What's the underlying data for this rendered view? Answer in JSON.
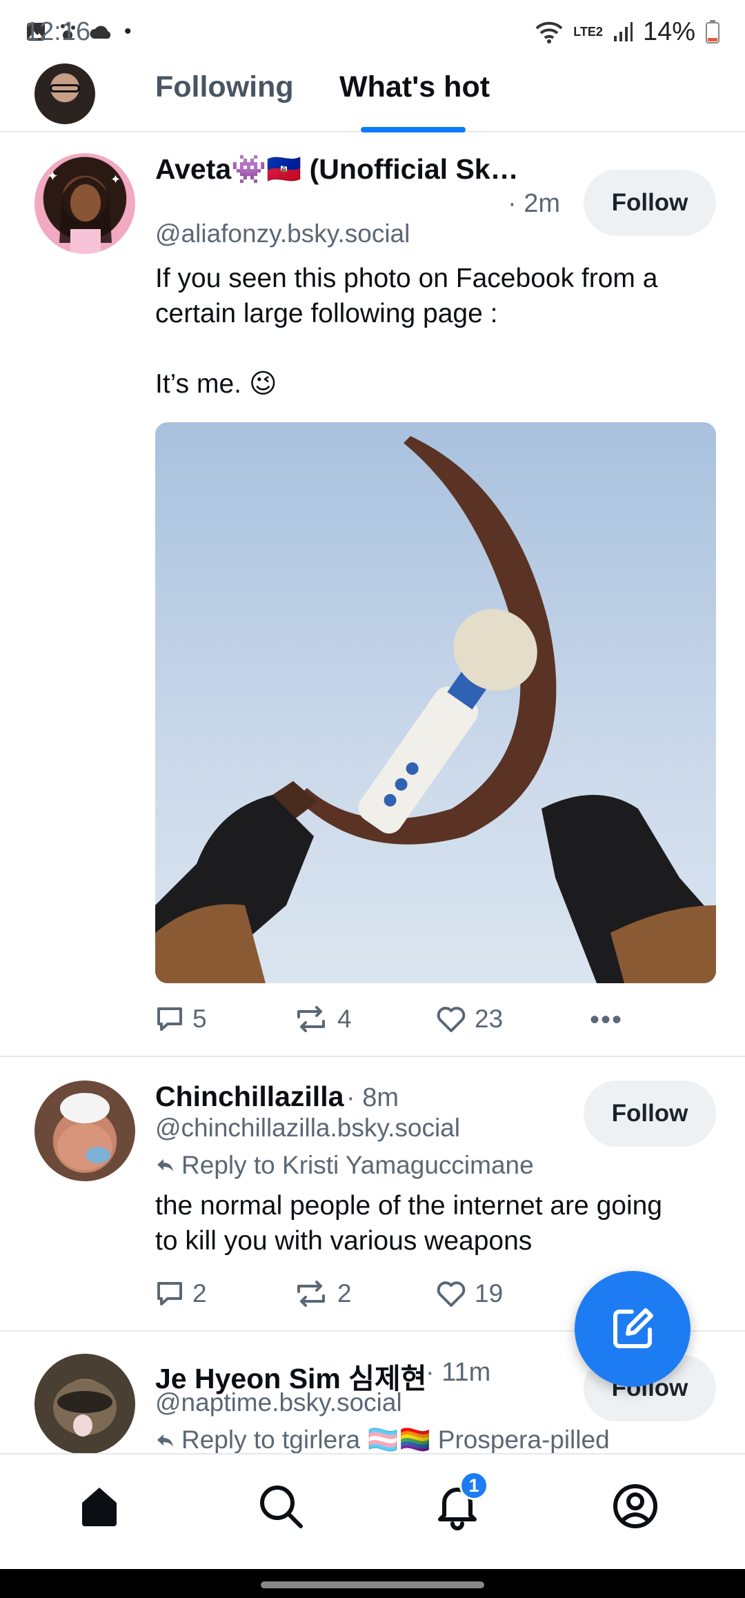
{
  "status_bar": {
    "time": "12:16",
    "network": "LTE2",
    "battery": "14%"
  },
  "header": {
    "tabs": [
      {
        "label": "Following",
        "active": false
      },
      {
        "label": "What's hot",
        "active": true
      }
    ]
  },
  "posts": [
    {
      "name": "Aveta👾🇭🇹 (Unofficial Sk…",
      "time": "· 2m",
      "handle": "@aliafonzy.bsky.social",
      "follow_label": "Follow",
      "text": "If you seen this photo on Facebook from a\ncertain large following page :\n\nIt’s me. 😉",
      "has_image": true,
      "replies": "5",
      "reposts": "4",
      "likes": "23"
    },
    {
      "name": "Chinchillazilla",
      "time": "· 8m",
      "handle": "@chinchillazilla.bsky.social",
      "follow_label": "Follow",
      "reply_to": "Reply to Kristi Yamaguccimane",
      "text": "the normal people of the internet are going\nto kill you with various weapons",
      "replies": "2",
      "reposts": "2",
      "likes": "19"
    },
    {
      "name": "Je Hyeon Sim 심제현",
      "time": "· 11m",
      "handle": "@naptime.bsky.social",
      "follow_label": "Follow",
      "reply_to": "Reply to tgirlera 🏳️‍⚧️🏳️‍🌈 Prospera-pilled"
    }
  ],
  "bottom_nav": {
    "items": [
      "home-icon",
      "search-icon",
      "notifications-icon",
      "profile-icon"
    ],
    "notification_count": "1"
  },
  "colors": {
    "accent": "#1e7cf2",
    "tab_underline": "#0a7aff",
    "muted_text": "#5b6775"
  }
}
